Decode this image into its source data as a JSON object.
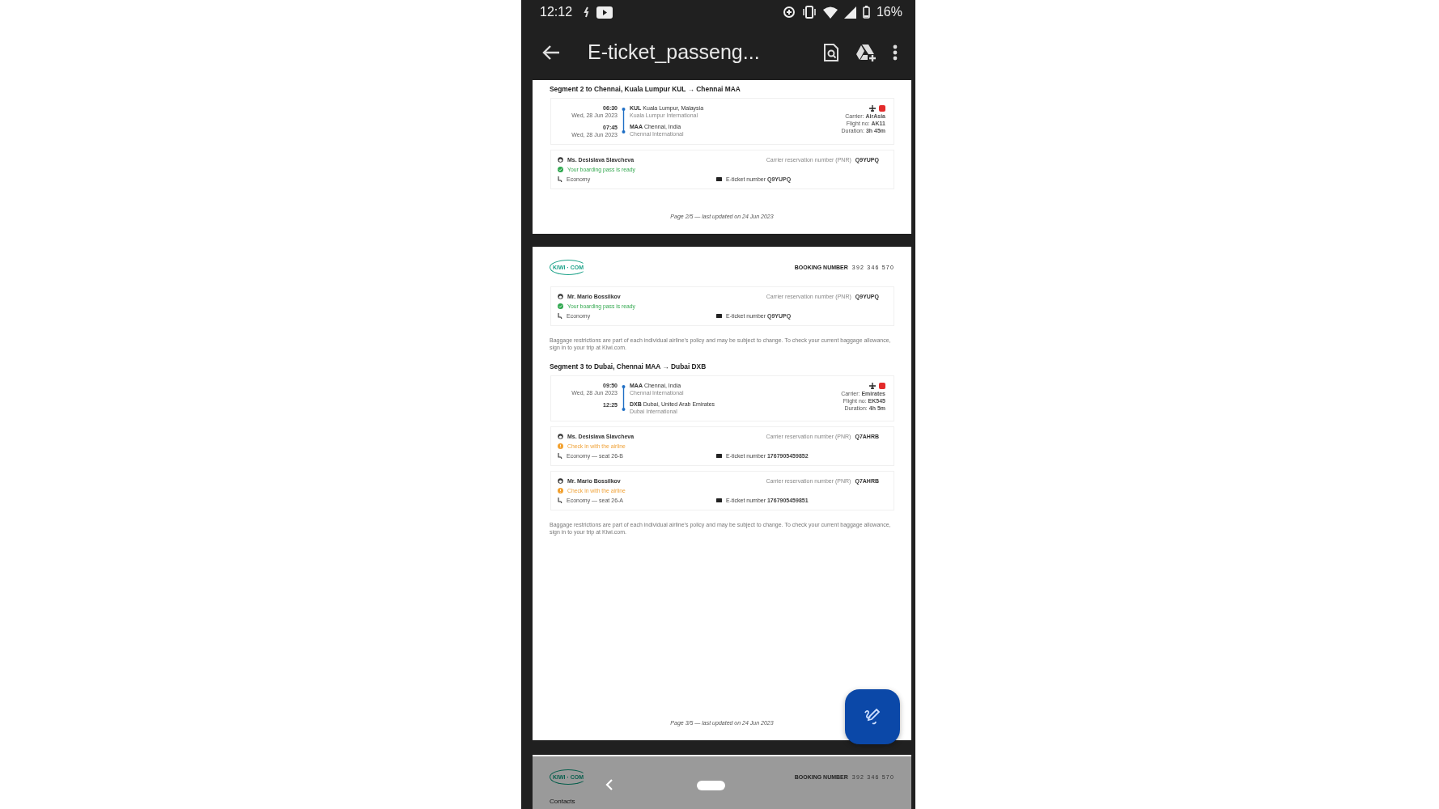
{
  "status_bar": {
    "time": "12:12",
    "battery": "16%"
  },
  "app_bar": {
    "title": "E-ticket_passeng..."
  },
  "pages": [
    {
      "kind": "cut",
      "blocks": [
        {
          "kind": "segment_title",
          "text": "Segment 2 to Chennai, Kuala Lumpur KUL → Chennai MAA"
        },
        {
          "kind": "flight",
          "dep_time": "06:30",
          "dep_date": "Wed, 28 Jun 2023",
          "dep_place": "**KUL** Kuala Lumpur, Malaysia",
          "dep_airport": "Kuala Lumpur International",
          "arr_time": "07:45",
          "arr_date": "Wed, 28 Jun 2023",
          "arr_place": "**MAA** Chennai, India",
          "arr_airport": "Chennai International",
          "carrier": "Carrier: **AirAsia**",
          "flight_no": "Flight no: **AK11**",
          "duration": "Duration: **3h 45m**"
        },
        {
          "kind": "passenger",
          "name": "Ms. Desislava Slavcheva",
          "pnr_label": "Carrier reservation number (PNR)",
          "pnr": "Q9YUPQ",
          "status": {
            "kind": "ready",
            "text": "Your boarding pass is ready"
          },
          "fare": "Economy",
          "eticket": "E-ticket number **Q9YUPQ**"
        }
      ],
      "footer": "Page 2/5 — last updated on 24 Jun 2023"
    },
    {
      "kind": "full",
      "header": {
        "logo": "KIWI · COM",
        "booking_label": "BOOKING NUMBER",
        "booking_number": "392 346 570"
      },
      "blocks": [
        {
          "kind": "passenger",
          "name": "Mr. Mario Bossilkov",
          "pnr_label": "Carrier reservation number (PNR)",
          "pnr": "Q9YUPQ",
          "status": {
            "kind": "ready",
            "text": "Your boarding pass is ready"
          },
          "fare": "Economy",
          "eticket": "E-ticket number **Q9YUPQ**"
        },
        {
          "kind": "note",
          "text": "Baggage restrictions are part of each individual airline’s policy and may be subject to change. To check your current baggage allowance, sign in to your trip at Kiwi.com."
        },
        {
          "kind": "segment_title",
          "text": "Segment 3 to Dubai, Chennai MAA → Dubai DXB"
        },
        {
          "kind": "flight",
          "dep_time": "09:50",
          "dep_date": "Wed, 28 Jun 2023",
          "dep_place": "**MAA** Chennai, India",
          "dep_airport": "Chennai International",
          "arr_time": "12:25",
          "arr_place": "**DXB** Dubai, United Arab Emirates",
          "arr_airport": "Dubai International",
          "carrier": "Carrier: **Emirates**",
          "flight_no": "Flight no: **EK545**",
          "duration": "Duration: **4h 5m**"
        },
        {
          "kind": "passenger",
          "name": "Ms. Desislava Slavcheva",
          "pnr_label": "Carrier reservation number (PNR)",
          "pnr": "Q7AHRB",
          "status": {
            "kind": "check_in",
            "text": "Check in with the airline"
          },
          "fare": "Economy — seat 26-B",
          "eticket": "E-ticket number **1767905459852**"
        },
        {
          "kind": "passenger",
          "name": "Mr. Mario Bossilkov",
          "pnr_label": "Carrier reservation number (PNR)",
          "pnr": "Q7AHRB",
          "status": {
            "kind": "check_in",
            "text": "Check in with the airline"
          },
          "fare": "Economy — seat 26-A",
          "eticket": "E-ticket number **1767905459851**"
        },
        {
          "kind": "note",
          "text": "Baggage restrictions are part of each individual airline’s policy and may be subject to change. To check your current baggage allowance, sign in to your trip at Kiwi.com."
        }
      ],
      "footer": "Page 3/5 — last updated on 24 Jun 2023"
    },
    {
      "kind": "dimmed",
      "header": {
        "logo": "KIWI · COM",
        "booking_label": "BOOKING NUMBER",
        "booking_number": "392 346 570"
      },
      "blocks": [
        {
          "kind": "section_title",
          "text": "Contacts"
        }
      ]
    }
  ]
}
